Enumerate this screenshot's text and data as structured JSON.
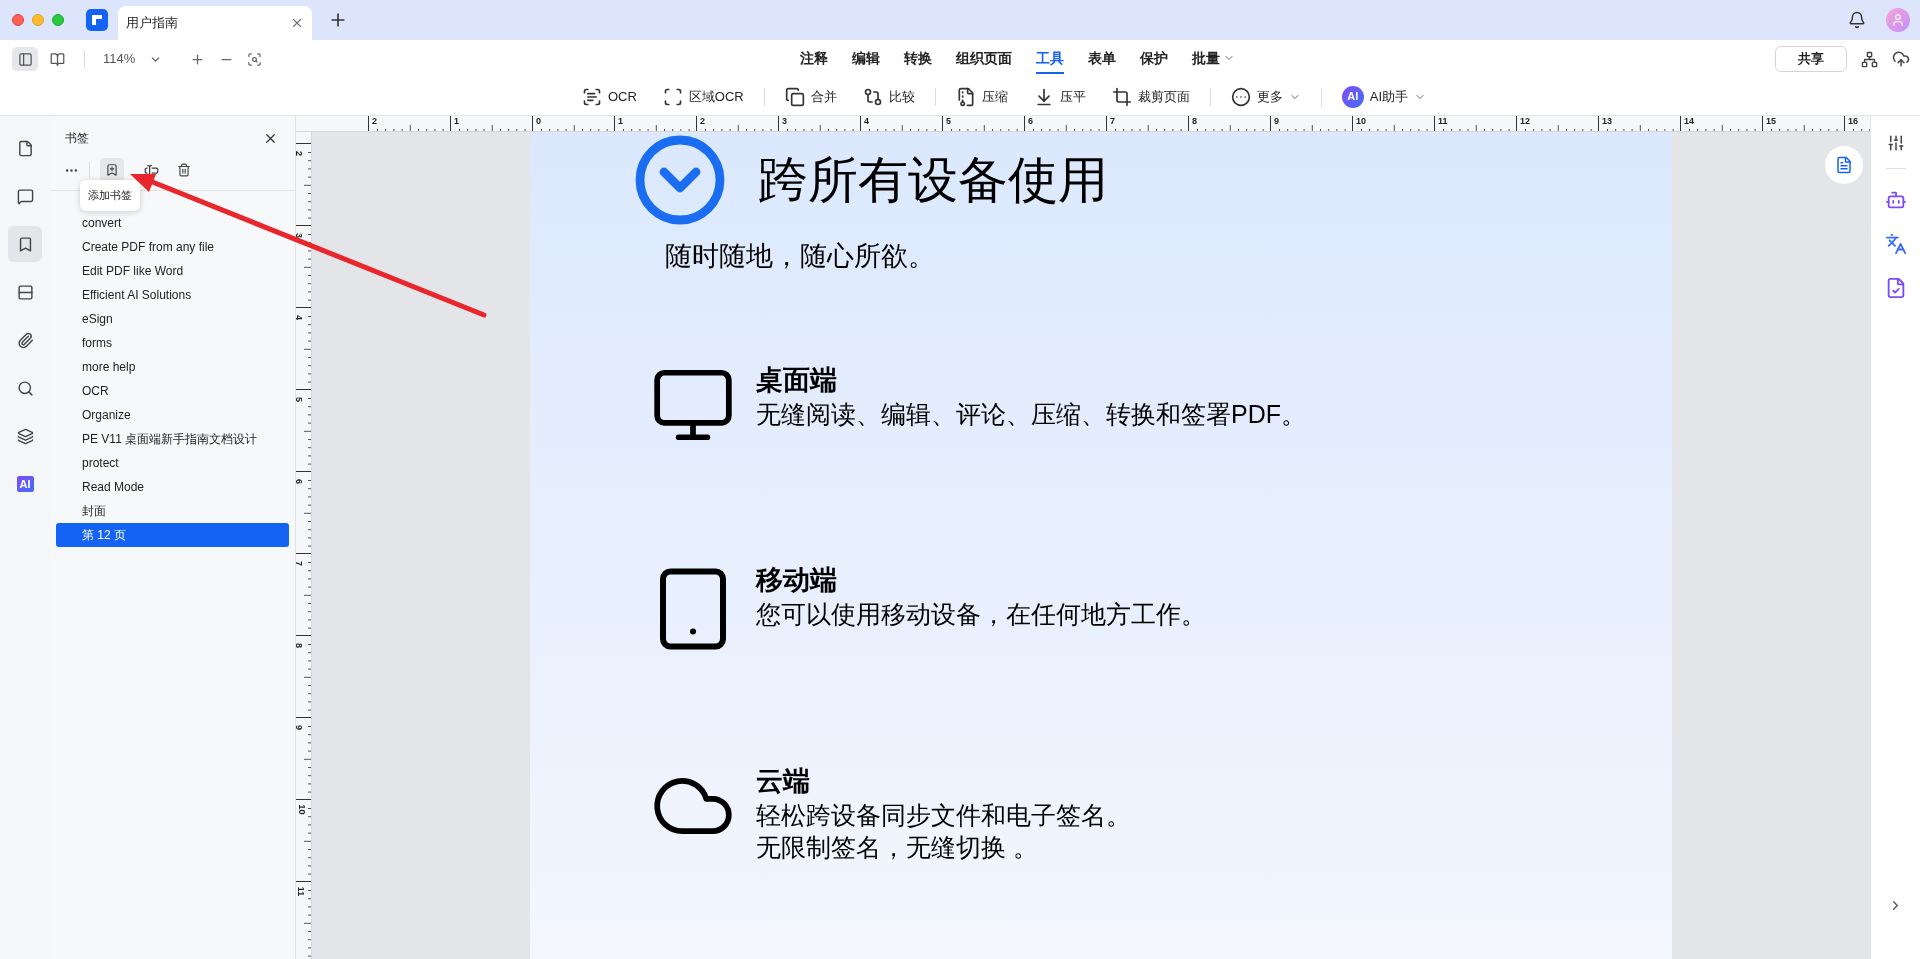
{
  "tab_bar": {
    "tabs": [
      {
        "label": "用户指南",
        "selected": true
      }
    ]
  },
  "toolbar": {
    "view_modes": [
      {
        "kind": "sidebar",
        "selected": true
      },
      {
        "kind": "reading",
        "selected": false
      }
    ],
    "zoom": "114%",
    "menu": [
      {
        "label": "注释",
        "selected": false
      },
      {
        "label": "编辑",
        "selected": false
      },
      {
        "label": "转换",
        "selected": false
      },
      {
        "label": "组织页面",
        "selected": false
      },
      {
        "label": "工具",
        "selected": true
      },
      {
        "label": "表单",
        "selected": false
      },
      {
        "label": "保护",
        "selected": false
      },
      {
        "label": "批量",
        "selected": false,
        "has_menu": true
      }
    ],
    "share": "共享"
  },
  "tool_groups": [
    [
      {
        "kind": "ocr",
        "label": "OCR"
      },
      {
        "kind": "area-ocr",
        "label": "区域OCR"
      }
    ],
    [
      {
        "kind": "merge",
        "label": "合并"
      },
      {
        "kind": "compare",
        "label": "比较"
      }
    ],
    [
      {
        "kind": "compress",
        "label": "压缩"
      },
      {
        "kind": "flatten",
        "label": "压平"
      },
      {
        "kind": "crop",
        "label": "裁剪页面"
      }
    ],
    [
      {
        "kind": "more",
        "label": "更多",
        "has_menu": true
      }
    ],
    [
      {
        "kind": "ai",
        "badge": "AI",
        "label": "AI助手",
        "has_menu": true
      }
    ]
  ],
  "left_rail": [
    {
      "kind": "pages",
      "selected": false
    },
    {
      "kind": "comments",
      "selected": false
    },
    {
      "kind": "bookmarks",
      "selected": true
    },
    {
      "kind": "fields",
      "selected": false
    },
    {
      "kind": "attachments",
      "selected": false
    },
    {
      "kind": "search",
      "selected": false
    },
    {
      "kind": "layers",
      "selected": false
    },
    {
      "kind": "ai",
      "label": "AI",
      "selected": false
    }
  ],
  "bookmarks": {
    "title": "书签",
    "tooltip": "添加书签",
    "items": [
      {
        "label": "convert",
        "selected": false
      },
      {
        "label": "Create PDF from any file",
        "selected": false
      },
      {
        "label": "Edit PDF like Word",
        "selected": false
      },
      {
        "label": "Efficient AI Solutions",
        "selected": false
      },
      {
        "label": "eSign",
        "selected": false
      },
      {
        "label": "forms",
        "selected": false
      },
      {
        "label": "more help",
        "selected": false
      },
      {
        "label": "OCR",
        "selected": false
      },
      {
        "label": "Organize",
        "selected": false
      },
      {
        "label": "PE V11 桌面端新手指南文档设计",
        "selected": false
      },
      {
        "label": "protect",
        "selected": false
      },
      {
        "label": "Read Mode",
        "selected": false
      },
      {
        "label": "封面",
        "selected": false
      },
      {
        "label": "第 12 页",
        "selected": true
      }
    ]
  },
  "ruler": {
    "horizontal": [
      "2",
      "1",
      "0",
      "1",
      "2",
      "3",
      "4",
      "5",
      "6",
      "7",
      "8",
      "9",
      "10",
      "11",
      "12",
      "13",
      "14",
      "15",
      "16"
    ],
    "vertical": [
      "2",
      "3",
      "4",
      "5",
      "6",
      "7",
      "8",
      "9",
      "10",
      "11"
    ]
  },
  "page": {
    "title": "跨所有设备使用",
    "subtitle": "随时随地，随心所欲。",
    "sections": [
      {
        "kind": "desktop",
        "heading": "桌面端",
        "lines": [
          "无缝阅读、编辑、评论、压缩、转换和签署PDF。"
        ]
      },
      {
        "kind": "mobile",
        "heading": "移动端",
        "lines": [
          "您可以使用移动设备，在任何地方工作。"
        ]
      },
      {
        "kind": "cloud",
        "heading": "云端",
        "lines": [
          "轻松跨设备同步文件和电子签名。",
          "无限制签名，无缝切换 。"
        ]
      }
    ]
  }
}
